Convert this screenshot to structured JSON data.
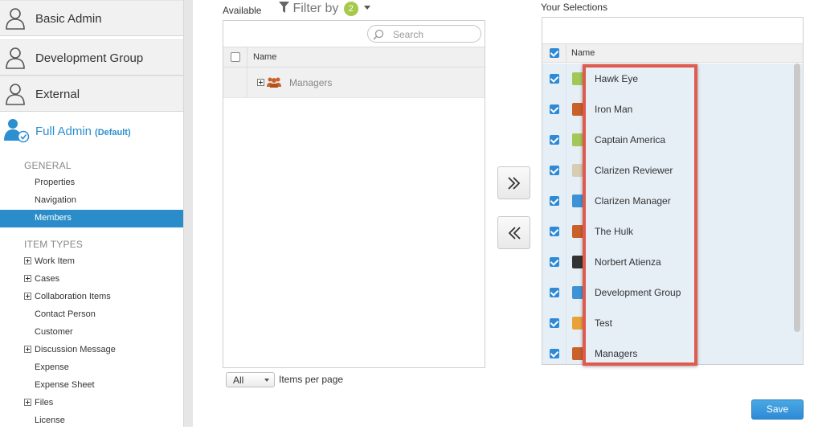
{
  "sidebar": {
    "groups": [
      {
        "label": "Basic Admin",
        "icon": "user-outline-icon"
      },
      {
        "label": "Development Group",
        "icon": "user-outline-icon"
      },
      {
        "label": "External",
        "icon": "user-outline-icon"
      }
    ],
    "active_group": {
      "label": "Full Admin",
      "badge": "(Default)",
      "icon": "user-check-icon"
    },
    "general_heading": "GENERAL",
    "general_items": [
      "Properties",
      "Navigation",
      "Members"
    ],
    "active_item": "Members",
    "item_types_heading": "ITEM TYPES",
    "item_types": [
      {
        "label": "Work Item",
        "expandable": true
      },
      {
        "label": "Cases",
        "expandable": true
      },
      {
        "label": "Collaboration Items",
        "expandable": true
      },
      {
        "label": "Contact Person",
        "expandable": false
      },
      {
        "label": "Customer",
        "expandable": false
      },
      {
        "label": "Discussion Message",
        "expandable": true
      },
      {
        "label": "Expense",
        "expandable": false
      },
      {
        "label": "Expense Sheet",
        "expandable": false
      },
      {
        "label": "Files",
        "expandable": true
      },
      {
        "label": "License",
        "expandable": false
      }
    ]
  },
  "available": {
    "title": "Available",
    "filter_label": "Filter by",
    "filter_count": "2",
    "search_placeholder": "Search",
    "column_name": "Name",
    "rows": [
      {
        "label": "Managers",
        "icon": "group-icon",
        "expandable": true
      }
    ],
    "paging_value": "All",
    "paging_label": "Items per page"
  },
  "selections": {
    "title": "Your Selections",
    "column_name": "Name",
    "rows": [
      {
        "label": "Hawk Eye",
        "checked": true,
        "avatar": "#a3c85a"
      },
      {
        "label": "Iron Man",
        "checked": true,
        "avatar": "#c9612a"
      },
      {
        "label": "Captain America",
        "checked": true,
        "avatar": "#a3c85a"
      },
      {
        "label": "Clarizen Reviewer",
        "checked": true,
        "avatar": "#d8cdb4"
      },
      {
        "label": "Clarizen Manager",
        "checked": true,
        "avatar": "#3d93d6"
      },
      {
        "label": "The Hulk",
        "checked": true,
        "avatar": "#c9612a"
      },
      {
        "label": "Norbert Atienza",
        "checked": true,
        "avatar": "#333333"
      },
      {
        "label": "Development Group",
        "checked": true,
        "avatar": "#3d93d6"
      },
      {
        "label": "Test",
        "checked": true,
        "avatar": "#e8a23a"
      },
      {
        "label": "Managers",
        "checked": true,
        "avatar": "#c9612a"
      }
    ]
  },
  "actions": {
    "save_label": "Save"
  },
  "colors": {
    "accent": "#2a8dc9",
    "highlight": "#e05a4e",
    "badge": "#a6c94c"
  }
}
